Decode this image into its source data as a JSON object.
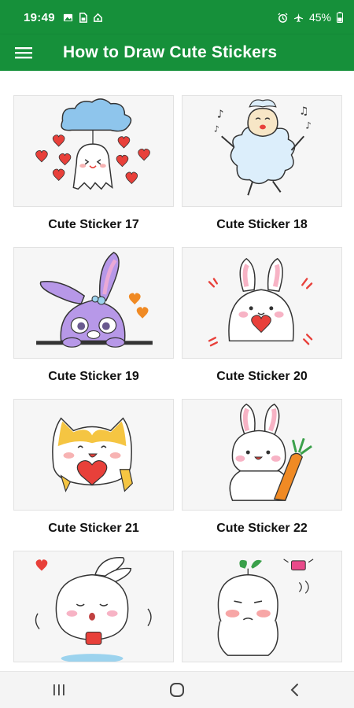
{
  "status_bar": {
    "time": "19:49",
    "battery": "45%",
    "left_icons": [
      "gallery-icon",
      "sim-card-icon",
      "home-icon"
    ],
    "right_icons": [
      "alarm-icon",
      "airplane-mode-icon",
      "battery-icon"
    ]
  },
  "app_bar": {
    "title": "How to Draw Cute Stickers",
    "menu_icon": "hamburger-menu-icon"
  },
  "stickers": [
    {
      "label": "Cute Sticker 17",
      "image": "ghost-with-cloud-and-hearts"
    },
    {
      "label": "Cute Sticker 18",
      "image": "dancing-sheep-with-music-notes"
    },
    {
      "label": "Cute Sticker 19",
      "image": "purple-bunny-peeking"
    },
    {
      "label": "Cute Sticker 20",
      "image": "bunny-holding-heart"
    },
    {
      "label": "Cute Sticker 21",
      "image": "cat-holding-heart"
    },
    {
      "label": "Cute Sticker 22",
      "image": "bunny-holding-carrot"
    },
    {
      "label": "",
      "image": "sleepy-bunny-with-cup"
    },
    {
      "label": "",
      "image": "sprout-character-thinking"
    }
  ],
  "nav_bar": {
    "icons": [
      "recent-apps-icon",
      "home-circle-icon",
      "back-icon"
    ]
  },
  "colors": {
    "brand_green": "#16903a",
    "heart_red": "#e8403a",
    "cloud_blue": "#8ec5ec",
    "bunny_purple": "#b798e8",
    "carrot_orange": "#f08a24"
  }
}
